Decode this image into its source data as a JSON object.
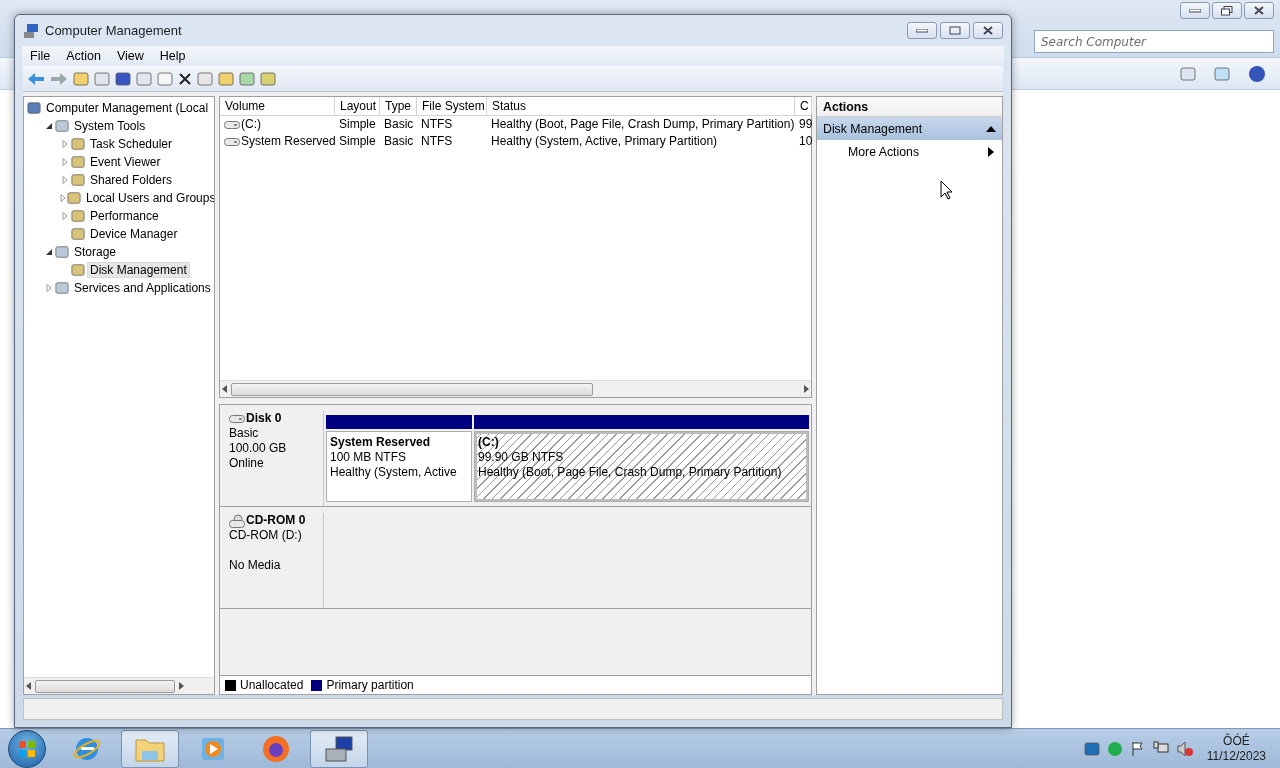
{
  "background_window": {
    "search": {
      "placeholder": "Search Computer"
    }
  },
  "window": {
    "title": "Computer Management"
  },
  "menu": [
    "File",
    "Action",
    "View",
    "Help"
  ],
  "tree": [
    {
      "label": "Computer Management (Local",
      "selected": false,
      "children": [
        {
          "label": "System Tools",
          "expanded": true,
          "selected": false,
          "children": [
            {
              "label": "Task Scheduler",
              "expanded": false,
              "selected": false
            },
            {
              "label": "Event Viewer",
              "expanded": false,
              "selected": false
            },
            {
              "label": "Shared Folders",
              "expanded": false,
              "selected": false
            },
            {
              "label": "Local Users and Groups",
              "expanded": false,
              "selected": false
            },
            {
              "label": "Performance",
              "expanded": false,
              "selected": false
            },
            {
              "label": "Device Manager",
              "selected": false
            }
          ]
        },
        {
          "label": "Storage",
          "expanded": true,
          "selected": false,
          "children": [
            {
              "label": "Disk Management",
              "selected": true
            }
          ]
        },
        {
          "label": "Services and Applications",
          "expanded": false,
          "selected": false
        }
      ]
    }
  ],
  "volumes": {
    "columns": [
      "Volume",
      "Layout",
      "Type",
      "File System",
      "Status",
      "C"
    ],
    "rows": [
      [
        "(C:)",
        "Simple",
        "Basic",
        "NTFS",
        "Healthy (Boot, Page File, Crash Dump, Primary Partition)",
        "99"
      ],
      [
        "System Reserved",
        "Simple",
        "Basic",
        "NTFS",
        "Healthy (System, Active, Primary Partition)",
        "10"
      ]
    ]
  },
  "disks": [
    {
      "kind": "disk",
      "name": "Disk 0",
      "type": "Basic",
      "size": "100.00 GB",
      "status": "Online",
      "partitions": [
        {
          "name": "System Reserved",
          "size": "100 MB NTFS",
          "status": "Healthy (System, Active",
          "selected": false
        },
        {
          "name": "(C:)",
          "size": "99.90 GB NTFS",
          "status": "Healthy (Boot, Page File, Crash Dump, Primary Partition)",
          "selected": true
        }
      ]
    },
    {
      "kind": "cdrom",
      "name": "CD-ROM 0",
      "type": "CD-ROM (D:)",
      "status": "No Media"
    }
  ],
  "legend": [
    {
      "label": "Unallocated",
      "color": "#000000"
    },
    {
      "label": "Primary partition",
      "color": "#000080"
    }
  ],
  "actions": {
    "title": "Actions",
    "section": "Disk Management",
    "items": [
      "More Actions"
    ]
  },
  "taskbar": {
    "apps": [
      {
        "kind": "ie",
        "open": false
      },
      {
        "kind": "explorer",
        "open": true
      },
      {
        "kind": "media",
        "open": false
      },
      {
        "kind": "firefox",
        "open": false
      },
      {
        "kind": "compmgmt",
        "open": true
      }
    ],
    "clock": {
      "time": "ÔÓÉ",
      "date": "11/12/2023"
    }
  }
}
